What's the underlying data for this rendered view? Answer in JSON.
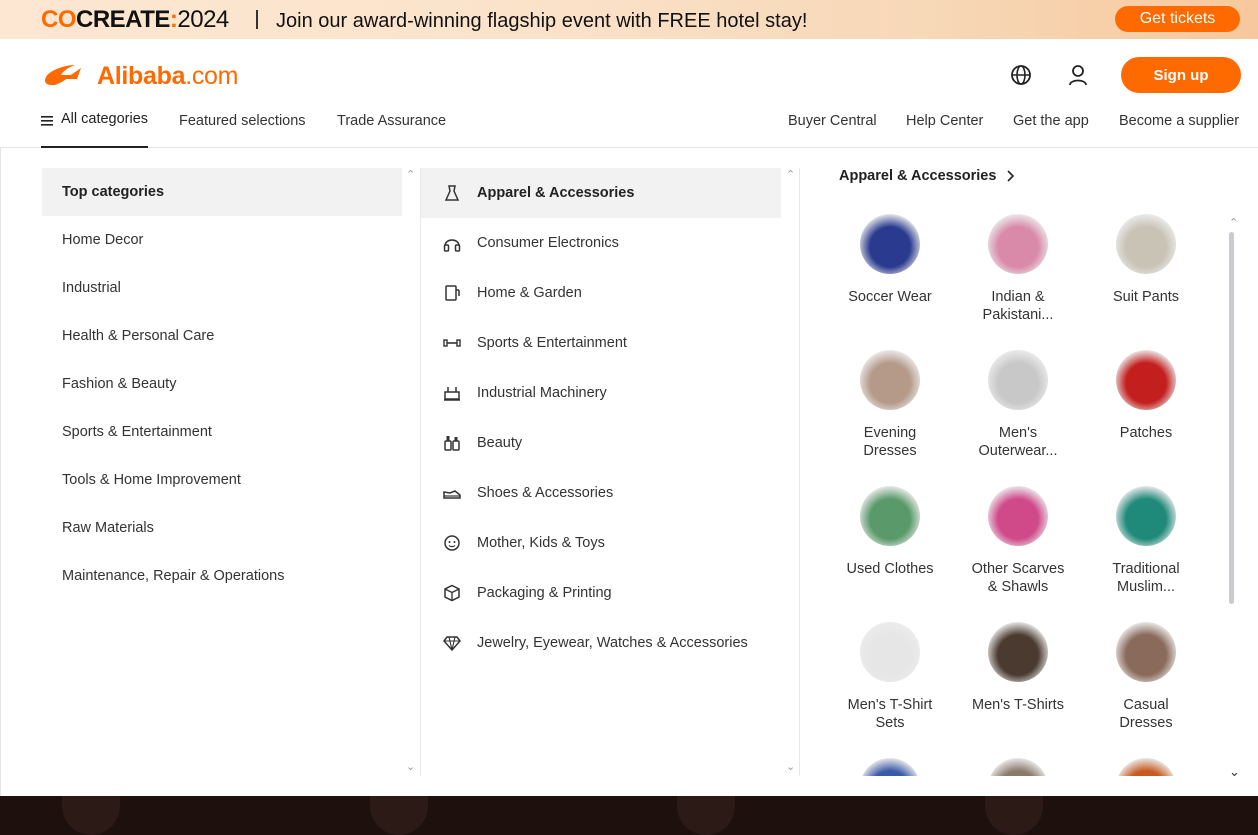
{
  "promo": {
    "brand_co": "CO",
    "brand_create": "CREATE",
    "brand_colon": ":",
    "brand_year": "2024",
    "message": "Join our award-winning flagship event with FREE hotel stay!",
    "cta": "Get tickets"
  },
  "header": {
    "logo_text": "Alibaba",
    "logo_suffix": ".com",
    "signup": "Sign up",
    "icons": [
      "globe-icon",
      "user-icon"
    ]
  },
  "nav": {
    "all_categories": "All categories",
    "left": [
      "Featured selections",
      "Trade Assurance"
    ],
    "right": [
      "Buyer Central",
      "Help Center",
      "Get the app",
      "Become a supplier"
    ]
  },
  "top_categories": [
    "Top categories",
    "Home Decor",
    "Industrial",
    "Health & Personal Care",
    "Fashion & Beauty",
    "Sports & Entertainment",
    "Tools & Home Improvement",
    "Raw Materials",
    "Maintenance, Repair & Operations"
  ],
  "categories": [
    {
      "label": "Apparel & Accessories",
      "icon": "dress-icon"
    },
    {
      "label": "Consumer Electronics",
      "icon": "headphones-icon"
    },
    {
      "label": "Home & Garden",
      "icon": "home-appliance-icon"
    },
    {
      "label": "Sports & Entertainment",
      "icon": "dumbbell-icon"
    },
    {
      "label": "Industrial Machinery",
      "icon": "machinery-icon"
    },
    {
      "label": "Beauty",
      "icon": "cosmetics-icon"
    },
    {
      "label": "Shoes & Accessories",
      "icon": "shoe-icon"
    },
    {
      "label": "Mother, Kids & Toys",
      "icon": "baby-icon"
    },
    {
      "label": "Packaging & Printing",
      "icon": "box-icon"
    },
    {
      "label": "Jewelry, Eyewear, Watches & Accessories",
      "icon": "diamond-icon"
    }
  ],
  "subcategory": {
    "title": "Apparel & Accessories",
    "items": [
      {
        "line1": "Soccer Wear",
        "line2": "",
        "color": "#2a3b8f"
      },
      {
        "line1": "Indian &",
        "line2": "Pakistani...",
        "color": "#d98aa8"
      },
      {
        "line1": "Suit Pants",
        "line2": "",
        "color": "#c9c3b6"
      },
      {
        "line1": "Evening",
        "line2": "Dresses",
        "color": "#b59a8a"
      },
      {
        "line1": "Men's",
        "line2": "Outerwear...",
        "color": "#c8c8c8"
      },
      {
        "line1": "Patches",
        "line2": "",
        "color": "#c41f1f"
      },
      {
        "line1": "Used Clothes",
        "line2": "",
        "color": "#5a9a6a"
      },
      {
        "line1": "Other Scarves",
        "line2": "& Shawls",
        "color": "#d04a8a"
      },
      {
        "line1": "Traditional",
        "line2": "Muslim...",
        "color": "#1f8a7a"
      },
      {
        "line1": "Men's T-Shirt",
        "line2": "Sets",
        "color": "#e6e6e6"
      },
      {
        "line1": "Men's T-Shirts",
        "line2": "",
        "color": "#4a3a30"
      },
      {
        "line1": "Casual",
        "line2": "Dresses",
        "color": "#8a6a5a"
      },
      {
        "line1": "",
        "line2": "",
        "color": "#3a5aa8"
      },
      {
        "line1": "",
        "line2": "",
        "color": "#8a7a6a"
      },
      {
        "line1": "",
        "line2": "",
        "color": "#c85a20"
      }
    ]
  }
}
